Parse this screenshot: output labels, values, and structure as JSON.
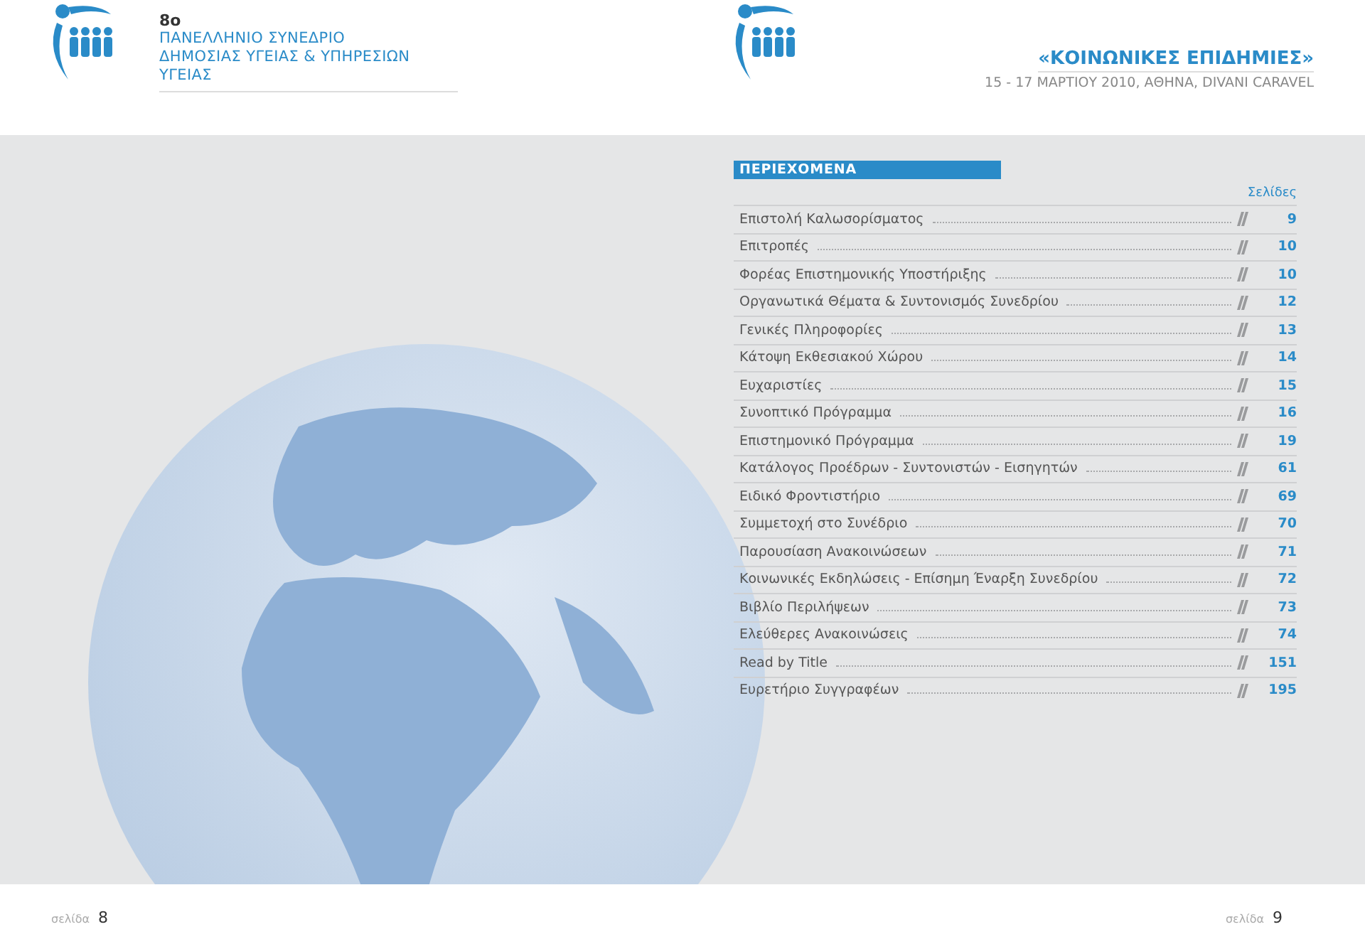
{
  "left_header": {
    "edition": "8ο",
    "line_1": "ΠΑΝΕΛΛΗΝΙΟ ΣΥΝΕΔΡΙΟ",
    "line_2": "ΔΗΜΟΣΙΑΣ ΥΓΕΙΑΣ & ΥΠΗΡΕΣΙΩΝ ΥΓΕΙΑΣ"
  },
  "right_header": {
    "title": "«ΚΟΙΝΩΝΙΚΕΣ ΕΠΙΔΗΜΙΕΣ»",
    "subtitle": "15 - 17 ΜΑΡΤΙΟΥ 2010, ΑΘΗΝΑ, DIVANI CARAVEL"
  },
  "contents": {
    "heading": "ΠΕΡΙΕΧΟΜΕΝΑ",
    "pages_label": "Σελίδες",
    "entries": [
      {
        "title": "Επιστολή Καλωσορίσματος",
        "page": "9"
      },
      {
        "title": "Επιτροπές",
        "page": "10"
      },
      {
        "title": "Φορέας Επιστημονικής Υποστήριξης",
        "page": "10"
      },
      {
        "title": "Οργανωτικά Θέματα & Συντονισμός Συνεδρίου",
        "page": "12"
      },
      {
        "title": "Γενικές Πληροφορίες",
        "page": "13"
      },
      {
        "title": "Κάτοψη Εκθεσιακού Χώρου",
        "page": "14"
      },
      {
        "title": "Ευχαριστίες",
        "page": "15"
      },
      {
        "title": "Συνοπτικό Πρόγραμμα",
        "page": "16"
      },
      {
        "title": "Επιστημονικό Πρόγραμμα",
        "page": "19"
      },
      {
        "title": "Κατάλογος Προέδρων - Συντονιστών - Εισηγητών",
        "page": "61"
      },
      {
        "title": "Ειδικό Φροντιστήριο",
        "page": "69"
      },
      {
        "title": "Συμμετοχή στο Συνέδριο",
        "page": "70"
      },
      {
        "title": "Παρουσίαση Ανακοινώσεων",
        "page": "71"
      },
      {
        "title": "Κοινωνικές Εκδηλώσεις - Επίσημη Έναρξη Συνεδρίου",
        "page": "72"
      },
      {
        "title": "Βιβλίο Περιλήψεων",
        "page": "73"
      },
      {
        "title": "Ελεύθερες Ανακοινώσεις",
        "page": "74"
      },
      {
        "title": "Read by Title",
        "page": "151"
      },
      {
        "title": "Ευρετήριο Συγγραφέων",
        "page": "195"
      }
    ]
  },
  "footer": {
    "left": {
      "label": "σελίδα",
      "number": "8"
    },
    "right": {
      "label": "σελίδα",
      "number": "9"
    }
  }
}
